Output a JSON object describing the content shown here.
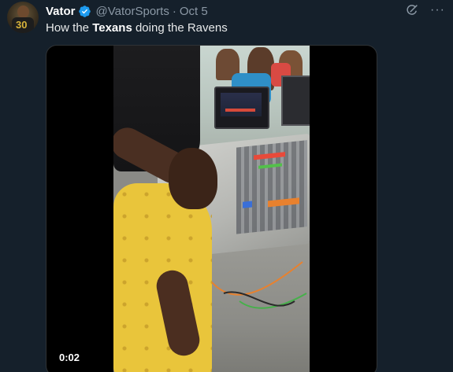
{
  "tweet": {
    "author_name": "Vator",
    "handle": "@VatorSports",
    "separator": "·",
    "date": "Oct 5",
    "verified_color": "#1d9bf0",
    "text_before": "How the ",
    "text_bold": "Texans",
    "text_after": " doing the Ravens",
    "avatar_jersey_number": "30"
  },
  "icons": {
    "verified": "verified-badge-icon",
    "grok": "grok-icon",
    "more": "more-options-icon",
    "more_glyph": "···"
  },
  "media": {
    "type": "video",
    "timestamp": "0:02"
  },
  "colors": {
    "background": "#15202b",
    "secondary_text": "#8b98a5",
    "primary_text": "#e7e9ea"
  }
}
